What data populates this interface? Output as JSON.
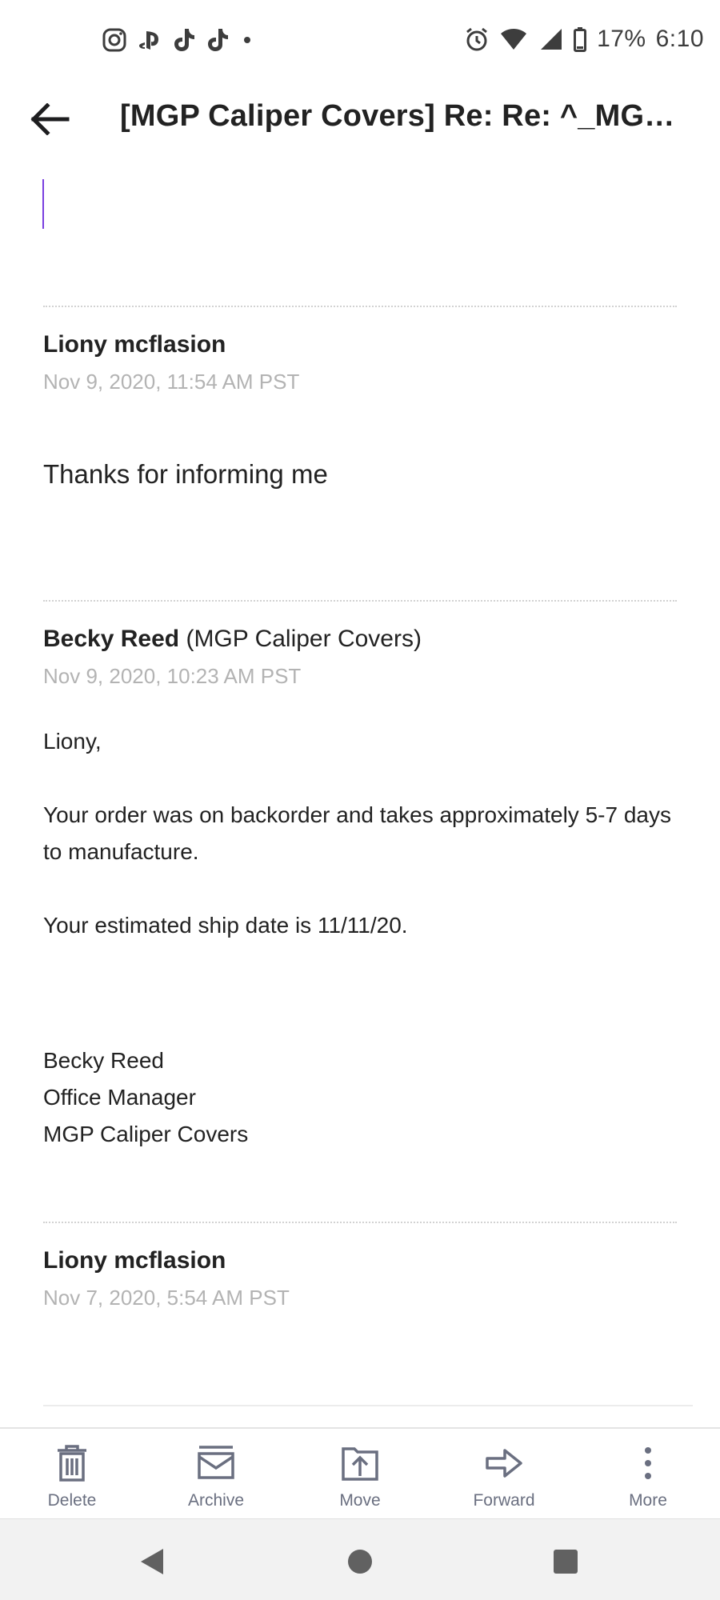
{
  "status_bar": {
    "notification_icons": [
      "instagram-icon",
      "playstation-icon",
      "tiktok-icon",
      "tiktok-icon",
      "dot-icon"
    ],
    "system_icons": [
      "alarm-icon",
      "wifi-icon",
      "signal-icon",
      "battery-icon"
    ],
    "battery": "17%",
    "time": "6:10"
  },
  "header": {
    "back_icon": "arrow-left-icon",
    "subject": "[MGP Caliper Covers] Re: Re: ^_MGP^_ ^_MGP^_ Order confirmation"
  },
  "messages": [
    {
      "sender": "Liony mcflasion",
      "org": "",
      "date": "Nov 9, 2020, 11:54 AM PST",
      "body": [
        "Thanks for informing me"
      ]
    },
    {
      "sender": "Becky Reed",
      "org": "(MGP Caliper Covers)",
      "date": "Nov 9, 2020, 10:23 AM PST",
      "body": [
        "Liony,",
        "Your order was on backorder and takes approximately 5-7 days to manufacture.",
        "Your estimated ship date is 11/11/20.",
        "Becky Reed",
        "Office Manager",
        "MGP Caliper Covers"
      ]
    },
    {
      "sender": "Liony mcflasion",
      "org": "",
      "date": "Nov 7, 2020, 5:54 AM PST",
      "body": []
    }
  ],
  "toolbar": {
    "items": [
      {
        "label": "Delete",
        "icon": "trash-icon"
      },
      {
        "label": "Archive",
        "icon": "archive-icon"
      },
      {
        "label": "Move",
        "icon": "move-icon"
      },
      {
        "label": "Forward",
        "icon": "forward-arrow-icon"
      },
      {
        "label": "More",
        "icon": "more-vertical-icon"
      }
    ]
  },
  "nav_bar": {
    "buttons": [
      "back-triangle-icon",
      "home-circle-icon",
      "recents-square-icon"
    ]
  },
  "colors": {
    "cursor": "#7a3fe0",
    "toolbar_icon": "#6a6f80",
    "date_text": "#b3b3b3"
  }
}
